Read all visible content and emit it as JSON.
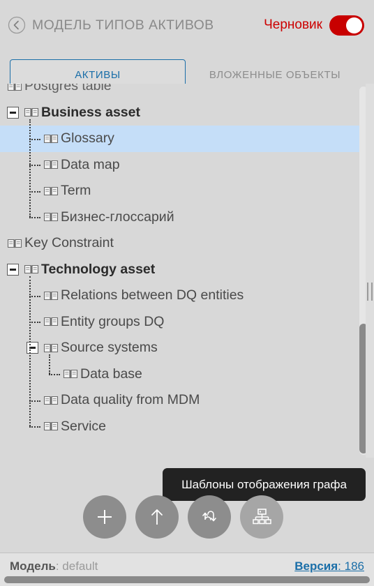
{
  "header": {
    "back_icon": "chevron-left-circle-icon",
    "title": "МОДЕЛЬ ТИПОВ АКТИВОВ",
    "draft_label": "Черновик",
    "draft_enabled": true,
    "accent_red": "#c80000",
    "title_color": "#8a8a8a"
  },
  "tabs": {
    "active_index": 0,
    "items": [
      {
        "label": "АКТИВЫ"
      },
      {
        "label": "ВЛОЖЕННЫЕ ОБЪЕКТЫ"
      }
    ],
    "accent_blue": "#1a6ea8"
  },
  "tree": {
    "selection_color": "#c5def8",
    "node_icon": "open-book-icon",
    "nodes": [
      {
        "label": "Postgres table",
        "depth": 0,
        "expander": "none",
        "bold": false,
        "selected": false,
        "clipped": true
      },
      {
        "label": "Business asset",
        "depth": 0,
        "expander": "collapse",
        "bold": true,
        "selected": false
      },
      {
        "label": "Glossary",
        "depth": 1,
        "expander": "none",
        "bold": false,
        "selected": true
      },
      {
        "label": "Data map",
        "depth": 1,
        "expander": "none",
        "bold": false,
        "selected": false
      },
      {
        "label": "Term",
        "depth": 1,
        "expander": "none",
        "bold": false,
        "selected": false
      },
      {
        "label": "Бизнес-глоссарий",
        "depth": 1,
        "expander": "none",
        "bold": false,
        "selected": false
      },
      {
        "label": "Key Constraint",
        "depth": 0,
        "expander": "none",
        "bold": false,
        "selected": false
      },
      {
        "label": "Technology asset",
        "depth": 0,
        "expander": "collapse",
        "bold": true,
        "selected": false
      },
      {
        "label": "Relations between DQ entities",
        "depth": 1,
        "expander": "none",
        "bold": false,
        "selected": false
      },
      {
        "label": "Entity groups DQ",
        "depth": 1,
        "expander": "none",
        "bold": false,
        "selected": false
      },
      {
        "label": "Source systems",
        "depth": 1,
        "expander": "collapse",
        "bold": false,
        "selected": false
      },
      {
        "label": "Data base",
        "depth": 2,
        "expander": "none",
        "bold": false,
        "selected": false
      },
      {
        "label": "Data quality from MDM",
        "depth": 1,
        "expander": "none",
        "bold": false,
        "selected": false
      },
      {
        "label": "Service",
        "depth": 1,
        "expander": "none",
        "bold": false,
        "selected": false
      }
    ]
  },
  "actions": {
    "buttons": [
      {
        "icon": "plus-icon",
        "name": "add-button",
        "highlighted": false
      },
      {
        "icon": "arrow-up-icon",
        "name": "move-up-button",
        "highlighted": false
      },
      {
        "icon": "sort-swap-icon",
        "name": "sort-button",
        "highlighted": false
      },
      {
        "icon": "hierarchy-icon",
        "name": "graph-templates-button",
        "highlighted": true
      }
    ]
  },
  "tooltip": {
    "text": "Шаблоны отображения графа"
  },
  "statusbar": {
    "model_key": "Модель",
    "model_sep": ": ",
    "model_value": "default",
    "version_key": "Версия",
    "version_sep": ": ",
    "version_value": "186",
    "link_color": "#1a6ea8"
  }
}
